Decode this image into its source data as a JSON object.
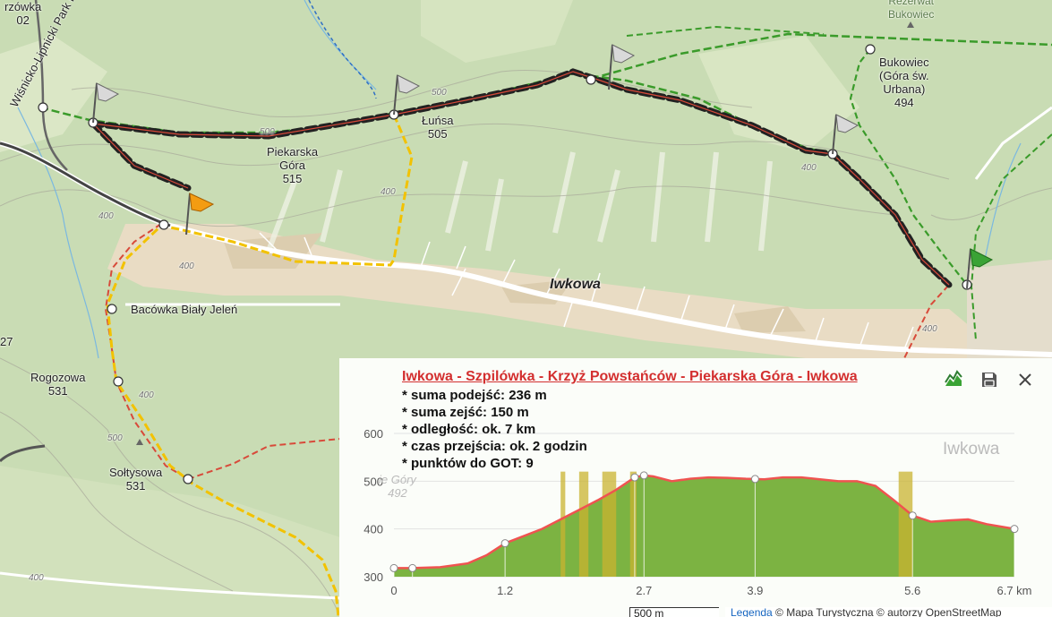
{
  "map": {
    "labels": {
      "park": "Wiśnicko-Lipnicki Park Krajobrazowy",
      "piekarska_a": "Piekarska",
      "piekarska_b": "Góra",
      "piekarska_c": "515",
      "lunsa_a": "Łuńsa",
      "lunsa_b": "505",
      "bukowiec_a": "Bukowiec",
      "bukowiec_b": "(Góra św.",
      "bukowiec_c": "Urbana)",
      "bukowiec_d": "494",
      "rezerwat_a": "Rezerwat",
      "rezerwat_b": "Bukowiec",
      "iwkowa": "Iwkowa",
      "iwkowa_under": "Iwkowa",
      "bacowka": "Bacówka Biały Jeleń",
      "rogozowa_a": "Rogozowa",
      "rogozowa_b": "531",
      "soltysowa_a": "Sołtysowa",
      "soltysowa_b": "531",
      "partial_top_a": "rzówka",
      "partial_top_b": "02",
      "partial_left": "27",
      "faint_peak_a": "ie Góry",
      "faint_peak_b": "492"
    },
    "contour_labels": [
      "500",
      "500",
      "400",
      "400",
      "400",
      "400",
      "400",
      "500",
      "400",
      "400"
    ],
    "colors": {
      "forest": "#c9dcb4",
      "village": "#e9dcc4",
      "trail_green": "#3a9b2a",
      "trail_red": "#d84a3a",
      "trail_yellow": "#f2c200",
      "route_black": "#222222",
      "profile_fill": "#7cb342",
      "profile_line": "#ef5350"
    }
  },
  "route": {
    "title": "Iwkowa - Szpilówka - Krzyż Powstańców  - Piekarska Góra - Iwkowa",
    "stats": [
      "* suma podejść: 236 m",
      "* suma zejść: 150 m",
      "* odległość: ok. 7 km",
      "* czas przejścia: ok. 2 godzin",
      "* punktów do GOT: 9"
    ],
    "icons": {
      "profile": "elevation-profile-icon",
      "save": "save-icon",
      "close": "close-icon"
    }
  },
  "chart_data": {
    "type": "area",
    "x": [
      0,
      0.2,
      0.5,
      0.8,
      1.0,
      1.2,
      1.4,
      1.6,
      1.8,
      2.0,
      2.2,
      2.4,
      2.6,
      2.7,
      2.8,
      3.0,
      3.2,
      3.4,
      3.6,
      3.8,
      4.0,
      4.2,
      4.4,
      4.6,
      4.8,
      5.0,
      5.2,
      5.4,
      5.6,
      5.8,
      6.0,
      6.2,
      6.4,
      6.7
    ],
    "y": [
      318,
      318,
      320,
      328,
      345,
      370,
      385,
      400,
      420,
      440,
      460,
      482,
      508,
      512,
      510,
      500,
      505,
      508,
      507,
      505,
      504,
      508,
      508,
      504,
      500,
      500,
      490,
      460,
      428,
      415,
      418,
      420,
      410,
      400
    ],
    "xticks": [
      "0",
      "1.2",
      "2.7",
      "3.9",
      "5.6",
      "6.7 km"
    ],
    "xtick_values": [
      0,
      1.2,
      2.7,
      3.9,
      5.6,
      6.7
    ],
    "yticks": [
      "300",
      "400",
      "500",
      "600"
    ],
    "ytick_values": [
      300,
      400,
      500,
      600
    ],
    "xlim": [
      0,
      6.7
    ],
    "ylim": [
      300,
      600
    ],
    "waypoints_x": [
      0,
      0.2,
      1.2,
      2.6,
      2.7,
      3.9,
      5.6,
      6.7
    ],
    "steep_bands": [
      [
        1.8,
        1.85
      ],
      [
        2.0,
        2.1
      ],
      [
        2.25,
        2.4
      ],
      [
        2.55,
        2.62
      ],
      [
        5.45,
        5.6
      ]
    ],
    "grid": true
  },
  "footer": {
    "scale": "500 m",
    "legend_link": "Legenda",
    "attribution": " © Mapa Turystyczna  © autorzy OpenStreetMap"
  }
}
